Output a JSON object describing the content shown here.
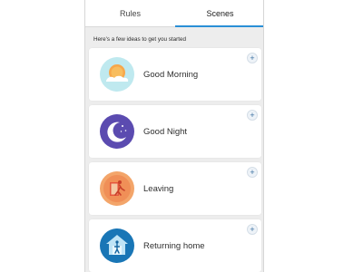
{
  "tabs": [
    {
      "label": "Rules",
      "active": false
    },
    {
      "label": "Scenes",
      "active": true
    }
  ],
  "hint_text": "Here's a few ideas to get you started",
  "add_symbol": "+",
  "scenes": [
    {
      "label": "Good Morning",
      "icon": "sunrise-icon",
      "color": "#bfe9ef"
    },
    {
      "label": "Good Night",
      "icon": "moon-stars-icon",
      "color": "#5b4bb0"
    },
    {
      "label": "Leaving",
      "icon": "person-leaving-icon",
      "color": "#f3a56a"
    },
    {
      "label": "Returning home",
      "icon": "home-icon",
      "color": "#1976b6"
    }
  ],
  "colors": {
    "accent": "#2a8fd6",
    "background": "#ededed",
    "card": "#ffffff"
  }
}
